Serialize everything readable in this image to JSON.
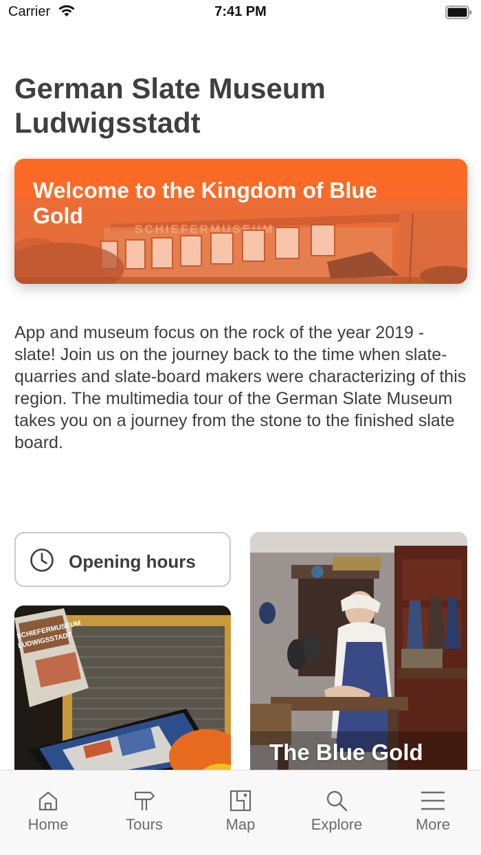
{
  "status_bar": {
    "carrier": "Carrier",
    "time": "7:41 PM"
  },
  "page": {
    "title": "German Slate Museum Ludwigsstadt"
  },
  "hero": {
    "title": "Welcome to the Kingdom of Blue Gold",
    "photo_sign_text": "SCHIEFERMUSEUM",
    "accent_color": "#ff6a22"
  },
  "description": "App and museum focus on the rock of the year 2019 - slate! Join us on the journey back to the time when slate-quarries and slate-board makers were characterizing of this region. The multimedia tour of the German Slate Museum takes you on a journey from the stone to the finished slate board.",
  "opening_hours": {
    "label": "Opening hours",
    "icon": "clock-icon"
  },
  "cards": {
    "media_tour": {
      "brochure_text": "SCHIEFERMUSEUM LUDWIGSSTADT"
    },
    "blue_gold": {
      "title": "The Blue Gold"
    }
  },
  "tab_bar": {
    "items": [
      {
        "label": "Home",
        "icon": "home-icon"
      },
      {
        "label": "Tours",
        "icon": "signpost-icon"
      },
      {
        "label": "Map",
        "icon": "map-icon"
      },
      {
        "label": "Explore",
        "icon": "search-icon"
      },
      {
        "label": "More",
        "icon": "menu-icon"
      }
    ],
    "color": "#6b6b6b"
  }
}
